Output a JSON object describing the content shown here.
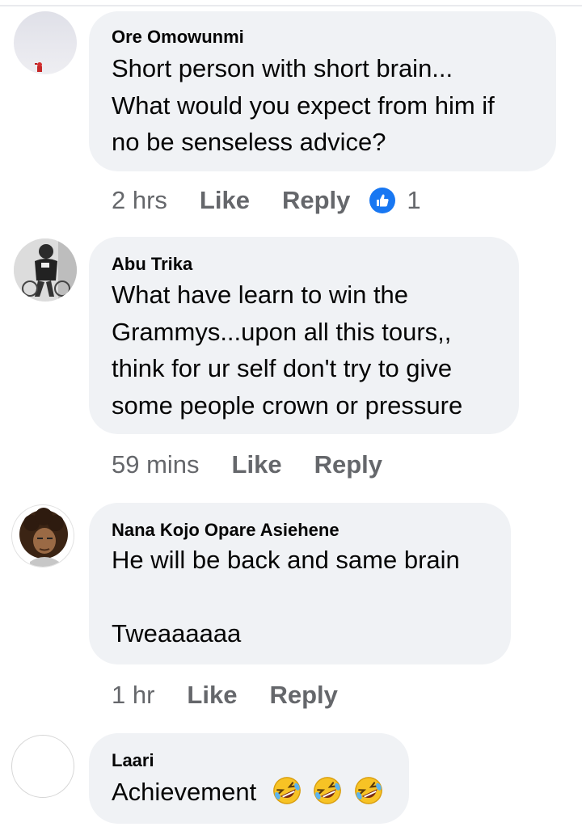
{
  "theme": {
    "bubble_bg": "#f0f2f5",
    "meta_text": "#65676b",
    "like_blue": "#1877f2"
  },
  "comments": [
    {
      "author": "Ore Omowunmi",
      "lines": "Short person with short brain...\nWhat would you expect from him if\nno be senseless advice?",
      "time": "2 hrs",
      "like_label": "Like",
      "reply_label": "Reply",
      "reaction_icon": "like-thumb-icon",
      "reaction_count": "1"
    },
    {
      "author": "Abu Trika",
      "lines": "What have learn to win the\nGrammys...upon all this tours,,\nthink for ur self don't try to give\nsome people crown or pressure",
      "time": "59 mins",
      "like_label": "Like",
      "reply_label": "Reply"
    },
    {
      "author": "Nana Kojo Opare Asiehene",
      "lines": "He will be back and same brain\n\nTweaaaaaa",
      "time": "1 hr",
      "like_label": "Like",
      "reply_label": "Reply"
    },
    {
      "author": "Laari",
      "lines": "Achievement",
      "emojis": [
        "rolling-on-floor-laughing-emoji",
        "rolling-on-floor-laughing-emoji",
        "rolling-on-floor-laughing-emoji"
      ]
    }
  ]
}
